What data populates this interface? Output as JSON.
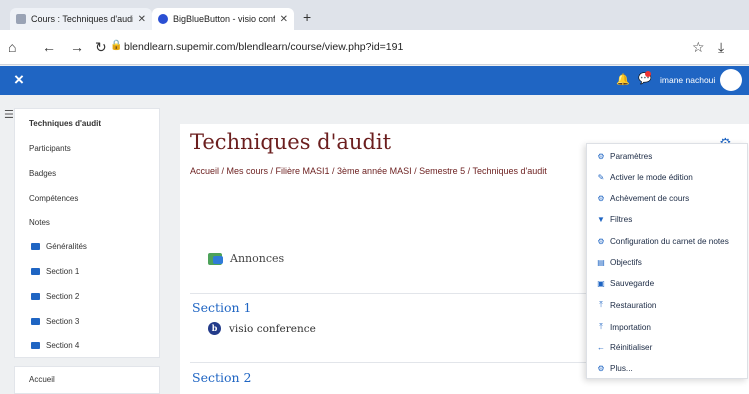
{
  "browser": {
    "tabs": [
      {
        "label": "Cours : Techniques d'audit"
      },
      {
        "label": "BigBlueButton - visio conferen"
      }
    ],
    "new_tab": "+",
    "url": "blendlearn.supemir.com/blendlearn/course/view.php?id=191"
  },
  "topnav": {
    "close": "×",
    "user_name": "imane nachoui"
  },
  "sidebar": {
    "items": [
      {
        "label": "Techniques d'audit"
      },
      {
        "label": "Participants"
      },
      {
        "label": "Badges"
      },
      {
        "label": "Compétences"
      },
      {
        "label": "Notes"
      },
      {
        "label": "Généralités"
      },
      {
        "label": "Section 1"
      },
      {
        "label": "Section 2"
      },
      {
        "label": "Section 3"
      },
      {
        "label": "Section 4"
      }
    ],
    "home": "Accueil"
  },
  "course": {
    "title": "Techniques d'audit",
    "breadcrumb": "Accueil / Mes cours / Filière MASI1 / 3ème année MASI / Semestre 5 / Techniques d'audit",
    "announcements": "Annonces",
    "section1": "Section 1",
    "visio": "visio conference",
    "section2": "Section 2"
  },
  "actions_menu": {
    "items": [
      {
        "label": "Paramètres",
        "icon": "gear-icon"
      },
      {
        "label": "Activer le mode édition",
        "icon": "pencil-icon"
      },
      {
        "label": "Achèvement de cours",
        "icon": "gear-icon"
      },
      {
        "label": "Filtres",
        "icon": "filter-icon"
      },
      {
        "label": "Configuration du carnet de notes",
        "icon": "gear-icon"
      },
      {
        "label": "Objectifs",
        "icon": "table-icon"
      },
      {
        "label": "Sauvegarde",
        "icon": "file-icon"
      },
      {
        "label": "Restauration",
        "icon": "upload-icon"
      },
      {
        "label": "Importation",
        "icon": "upload-icon"
      },
      {
        "label": "Réinitialiser",
        "icon": "arrow-left-icon"
      },
      {
        "label": "Plus...",
        "icon": "gear-icon"
      }
    ]
  },
  "colors": {
    "navbar": "#1f65c3",
    "title": "#6b1e1e",
    "link": "#1f65c3"
  }
}
